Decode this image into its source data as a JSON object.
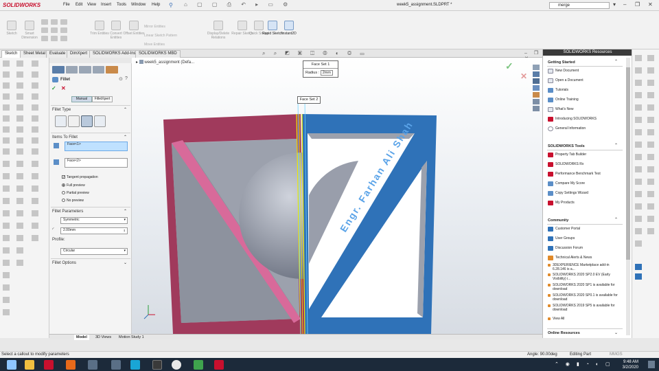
{
  "app": {
    "logo": "SOLIDWORKS",
    "doc_title": "week5_assignment.SLDPRT *"
  },
  "menu": [
    "File",
    "Edit",
    "View",
    "Insert",
    "Tools",
    "Window",
    "Help"
  ],
  "search": {
    "value": "merge"
  },
  "command_manager": {
    "tools": [
      "Sketch",
      "Smart Dimension",
      "Trim Entities",
      "Convert Entities",
      "Offset Entities",
      "Display/Delete Relations",
      "Repair Sketch",
      "Quick Snaps",
      "Rapid Sketch",
      "Instant2D"
    ],
    "small_tools": [
      "Mirror Entities",
      "Linear Sketch Pattern",
      "Move Entities"
    ]
  },
  "tabs": [
    "Sketch",
    "Sheet Metal",
    "Evaluate",
    "DimXpert",
    "SOLIDWORKS Add-Ins",
    "SOLIDWORKS MBD"
  ],
  "tree": {
    "node": "week5_assignment (Defa..."
  },
  "property_manager": {
    "title": "Fillet",
    "modes": [
      "Manual",
      "FilletXpert"
    ],
    "fillet_type_label": "Fillet Type",
    "items_label": "Items To Fillet",
    "face1": "Face<1>",
    "face2": "Face<2>",
    "tangent": "Tangent propagation",
    "preview_options": [
      "Full preview",
      "Partial preview",
      "No preview"
    ],
    "params_label": "Fillet Parameters",
    "symmetric": "Symmetric",
    "radius": "2.00mm",
    "profile_label": "Profile:",
    "profile": "Circular",
    "options_label": "Fillet Options"
  },
  "viewport": {
    "face_set1": "Face Set 1",
    "radius_label": "Radius",
    "radius_value": "2mm",
    "face_set2": "Face Set 2",
    "engraving": "Engr. Farhan Ali Shah"
  },
  "task_pane": {
    "title": "SOLIDWORKS Resources",
    "sections": [
      {
        "head": "Getting Started",
        "items": [
          "New Document",
          "Open a Document",
          "Tutorials",
          "Online Training",
          "What's New",
          "Introducing SOLIDWORKS",
          "General Information"
        ]
      },
      {
        "head": "SOLIDWORKS Tools",
        "items": [
          "Property Tab Builder",
          "SOLIDWORKS Rx",
          "Performance Benchmark Test",
          "Compare My Score",
          "Copy Settings Wizard",
          "My Products"
        ]
      },
      {
        "head": "Community",
        "items": [
          "Customer Portal",
          "User Groups",
          "Discussion Forum",
          "Technical Alerts & News"
        ]
      }
    ],
    "news": [
      "3DEXPERIENCE Marketplace add-in 6.28.146 is a...",
      "SOLIDWORKS 2020 SP2.0 EV (Early Visibility) i...",
      "SOLIDWORKS 2020 SP1 is available for download",
      "SOLIDWORKS 2020 SP0.1 is available for download",
      "SOLIDWORKS 2019 SP5 is available for download"
    ],
    "view_all": "View All",
    "online_resources": "Online Resources"
  },
  "bottom_tabs": [
    "Model",
    "3D Views",
    "Motion Study 1"
  ],
  "status": {
    "hint": "Select a callout to modify parameters",
    "angle": "Angle: 90.00deg",
    "mode": "Editing Part",
    "units": "MMGS"
  },
  "clock": {
    "time": "9:48 AM",
    "date": "3/2/2020"
  },
  "colors": {
    "brand": "#c8102e",
    "left_face": "#a03a5c",
    "right_face": "#2f72b8",
    "interior": "#9ca1ad"
  }
}
